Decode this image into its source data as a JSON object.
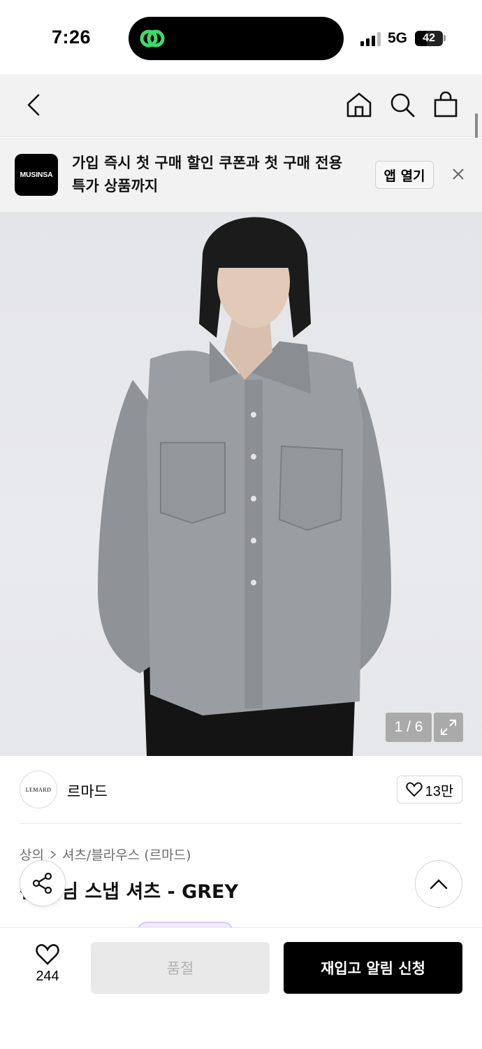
{
  "status_bar": {
    "time": "7:26",
    "network": "5G",
    "battery": "42",
    "battery_level": 0.42
  },
  "nav": {
    "back_icon": "chevron-left-icon",
    "home_icon": "home-icon",
    "search_icon": "search-icon",
    "cart_icon": "shopping-bag-icon"
  },
  "app_banner": {
    "logo_text": "MUSINSA",
    "message": "가입 즉시 첫 구매 할인 쿠폰과 첫 구매 전용 특가 상품까지",
    "open_label": "앱 열기",
    "close_icon": "close-icon"
  },
  "gallery": {
    "counter": "1 / 6",
    "expand_icon": "expand-icon"
  },
  "brand": {
    "logo_text": "LEMARD",
    "name": "르마드",
    "like_count": "13만"
  },
  "breadcrumb": {
    "category": "상의",
    "subcategory": "셔츠/블라우스 (르마드)"
  },
  "product": {
    "title_visible": "선 데님 스냅 셔츠 - GREY"
  },
  "bottom_bar": {
    "wish_count": "244",
    "soldout_label": "품절",
    "restock_label": "재입고 알림 신청"
  },
  "colors": {
    "accent": "#000000",
    "disabled_bg": "#e9e9ea",
    "banner_bg": "#f2f2f3"
  }
}
